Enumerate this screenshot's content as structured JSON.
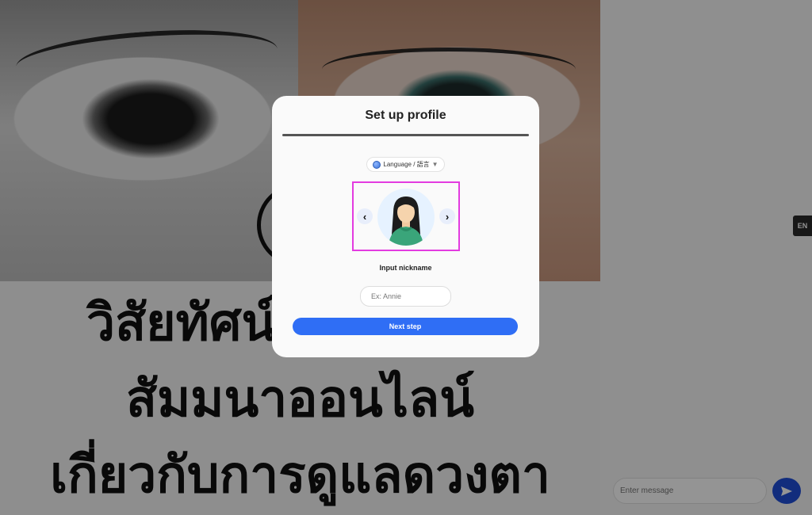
{
  "background": {
    "headline_lines": [
      "วิสัยทัศน์ใหม่ในการ",
      "สัมมนาออนไลน์",
      "เกี่ยวกับการดูแลดวงตา"
    ]
  },
  "side_panel": {
    "language_badge": "EN",
    "message_placeholder": "Enter message",
    "send_icon": "send-icon"
  },
  "modal": {
    "title": "Set up profile",
    "language_select_label": "Language / 語言",
    "language_icon": "globe-icon",
    "carousel": {
      "prev_label": "‹",
      "next_label": "›",
      "avatar_icon": "female-avatar-icon"
    },
    "nickname_label": "Input nickname",
    "nickname_placeholder": "Ex: Annie",
    "next_button_label": "Next step"
  },
  "colors": {
    "accent_blue": "#2f6ef5",
    "send_blue": "#1f4fd8",
    "selection_outline": "#e33be0"
  }
}
